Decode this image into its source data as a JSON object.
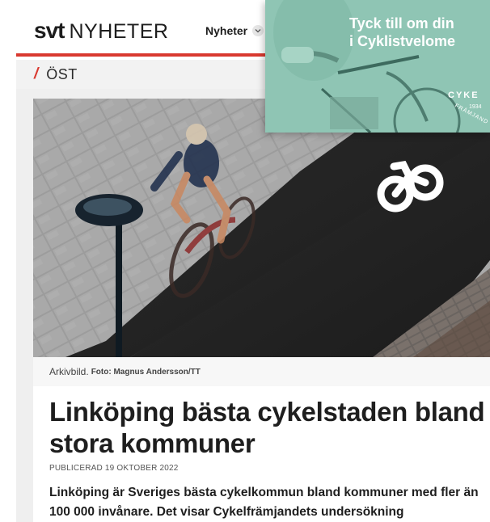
{
  "header": {
    "logo_svt": "svt",
    "logo_nyheter": "NYHETER",
    "nav_label": "Nyheter",
    "nav_icon": "chevron-down-icon"
  },
  "section": {
    "slash": "/",
    "label": "ÖST"
  },
  "ad": {
    "headline_line1": "Tyck till om din",
    "headline_line2": "i Cyklistvelome",
    "brand": "CYKE",
    "year": "1934",
    "sub": "FRÄMJAND"
  },
  "image": {
    "caption": "Arkivbild.",
    "credit": "Foto: Magnus Andersson/TT"
  },
  "article": {
    "headline": "Linköping bästa cykelstaden bland stora kommuner",
    "published": "PUBLICERAD 19 OKTOBER 2022",
    "lead": "Linköping är Sveriges bästa cykelkommun bland kommuner med fler än 100 000 invånare. Det visar Cykelfrämjandets undersökning"
  },
  "colors": {
    "accent_red": "#d9392f",
    "ad_teal": "#8fc5b4"
  }
}
